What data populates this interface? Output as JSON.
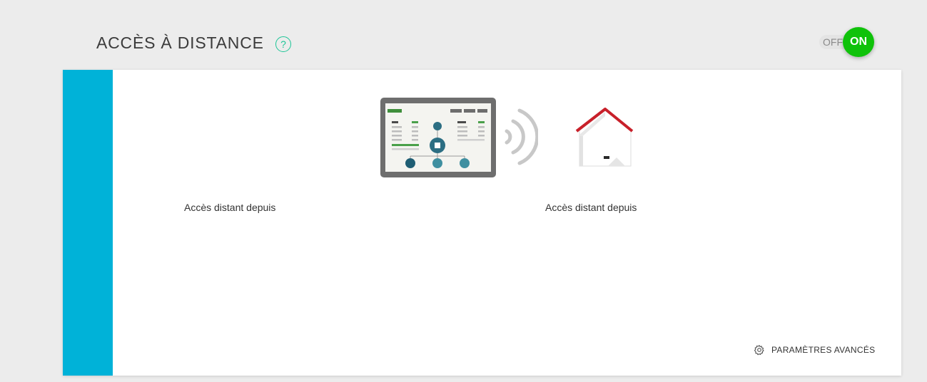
{
  "header": {
    "title": "ACCÈS À DISTANCE",
    "help_label": "?"
  },
  "toggle": {
    "off_label": "OFF",
    "on_label": "ON",
    "state": "on",
    "on_color": "#0fc20a"
  },
  "card": {
    "accent_color": "#00b2d8",
    "left_label": "Accès distant depuis",
    "right_label": "Accès distant depuis",
    "advanced_settings_label": "PARAMÈTRES AVANCÉS",
    "advanced_settings_icon": "gear-icon"
  },
  "illustrations": {
    "tablet_icon": "tablet-dashboard-icon",
    "signal_icon": "wifi-waves-icon",
    "house_icon": "house-icon"
  }
}
